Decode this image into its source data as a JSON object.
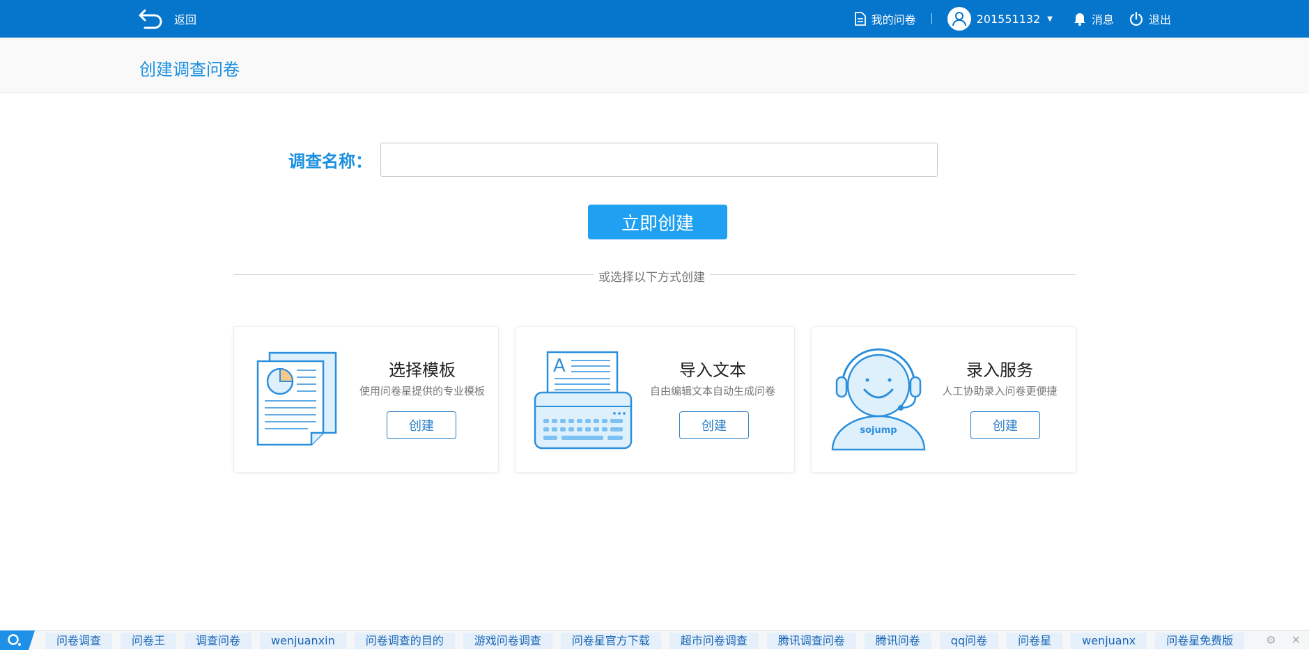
{
  "topbar": {
    "back_label": "返回",
    "my_surveys": "我的问卷",
    "username": "201551132",
    "messages": "消息",
    "logout": "退出"
  },
  "page": {
    "title": "创建调查问卷"
  },
  "form": {
    "name_label": "调查名称：",
    "name_value": "",
    "create_button": "立即创建"
  },
  "divider_text": "或选择以下方式创建",
  "cards": [
    {
      "title": "选择模板",
      "desc": "使用问卷星提供的专业模板",
      "button": "创建"
    },
    {
      "title": "导入文本",
      "desc": "自由编辑文本自动生成问卷",
      "button": "创建"
    },
    {
      "title": "录入服务",
      "desc": "人工协助录入问卷更便捷",
      "button": "创建",
      "logo_text": "sojump"
    }
  ],
  "bottom_tags": [
    "问卷调查",
    "问卷王",
    "调查问卷",
    "wenjuanxin",
    "问卷调查的目的",
    "游戏问卷调查",
    "问卷星官方下载",
    "超市问卷调查",
    "腾讯调查问卷",
    "腾讯问卷",
    "qq问卷",
    "问卷星",
    "wenjuanx",
    "问卷星免费版"
  ],
  "colors": {
    "primary": "#0675cc",
    "accent": "#1fa0f0",
    "title_blue": "#1a8fe0"
  }
}
